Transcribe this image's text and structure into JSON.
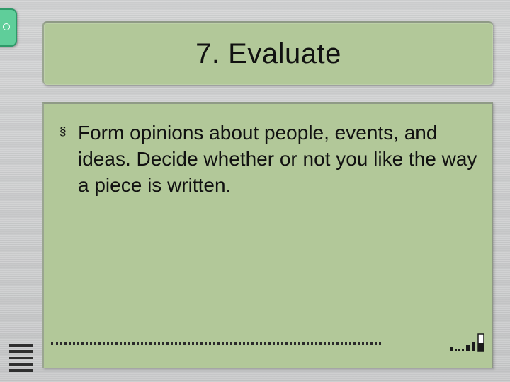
{
  "slide": {
    "title": "7. Evaluate",
    "bullets": [
      {
        "marker": "§",
        "text": "Form opinions about people, events, and ideas. Decide whether or not you like the way a piece is written."
      }
    ]
  },
  "icons": {
    "tab_marker": "ring-icon",
    "menu": "hamburger-icon",
    "signal": "signal-bars-icon"
  },
  "colors": {
    "panel_green": "#b2c899",
    "tab_green": "#5fce9a",
    "background_gray": "#c9cacb",
    "text": "#111111"
  }
}
